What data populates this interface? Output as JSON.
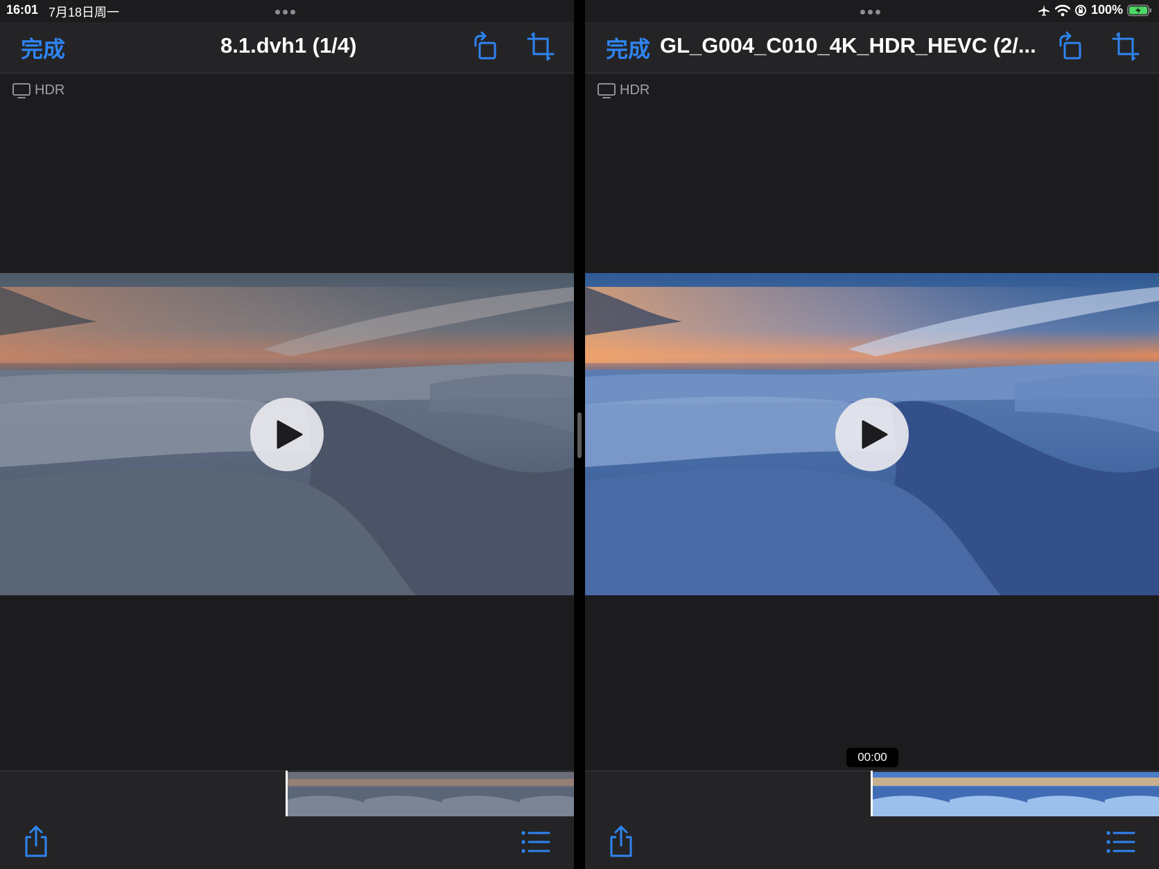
{
  "status_bar": {
    "time": "16:01",
    "date": "7月18日周一",
    "battery": "100%"
  },
  "left_pane": {
    "done_label": "完成",
    "title": "8.1.dvh1 (1/4)",
    "hdr_label": "HDR"
  },
  "right_pane": {
    "done_label": "完成",
    "title": "GL_G004_C010_4K_HDR_HEVC (2/...",
    "hdr_label": "HDR",
    "scrub_time": "00:00"
  },
  "icons": {
    "rotate": "rotate-icon",
    "crop": "crop-icon",
    "share": "share-icon",
    "list": "list-icon",
    "play": "play-icon",
    "display": "display-icon"
  },
  "colors": {
    "accent": "#2f84f2",
    "pane_bg": "#1c1c1e",
    "bar_bg": "#242426",
    "battery_green": "#4cd964"
  }
}
